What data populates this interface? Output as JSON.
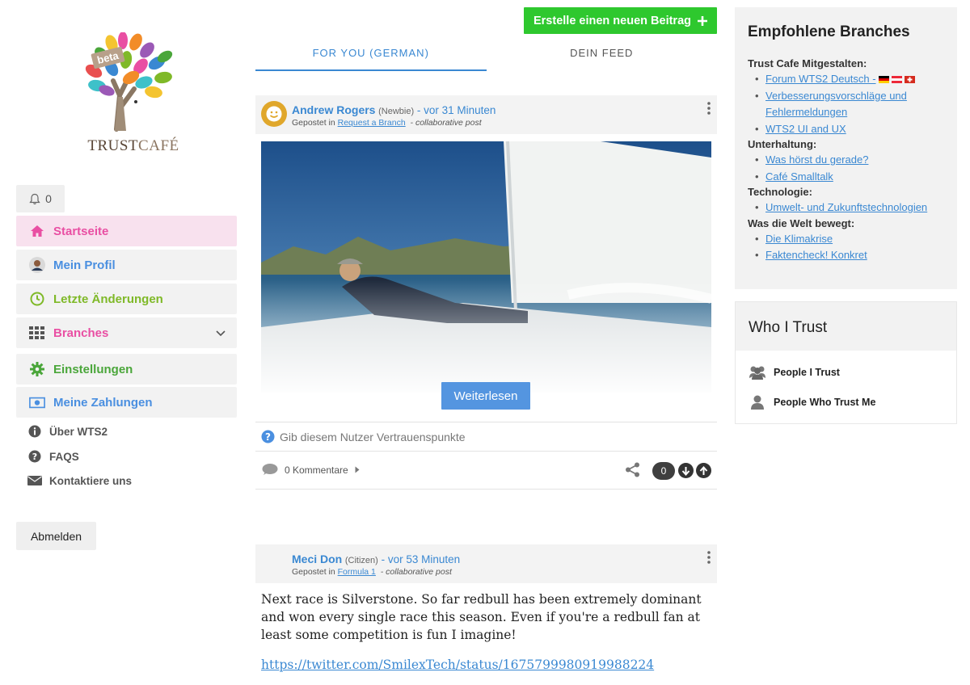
{
  "brand": {
    "beta": "beta",
    "word_trust": "TRUST",
    "word_cafe": "CAFÉ"
  },
  "notifications": {
    "count": "0",
    "icon": "bell-icon"
  },
  "nav": {
    "home": {
      "label": "Startseite",
      "color": "#e94fa3",
      "icon": "home-icon"
    },
    "profile": {
      "label": "Mein Profil",
      "color": "#4a8fe0",
      "icon": "avatar-icon"
    },
    "recent": {
      "label": "Letzte Änderungen",
      "color": "#7fb928",
      "icon": "clock-icon"
    },
    "branches": {
      "label": "Branches",
      "color": "#e94fa3",
      "icon": "grid-icon"
    },
    "settings": {
      "label": "Einstellungen",
      "color": "#4aa63a",
      "icon": "gear-icon"
    },
    "payments": {
      "label": "Meine Zahlungen",
      "color": "#4a8fe0",
      "icon": "money-icon"
    }
  },
  "mini_links": {
    "about": "Über WTS2",
    "faqs": "FAQS",
    "contact": "Kontaktiere uns"
  },
  "logout": "Abmelden",
  "new_post_button": "Erstelle einen neuen Beitrag",
  "tabs": [
    {
      "label": "FOR YOU (GERMAN)",
      "active": true
    },
    {
      "label": "DEIN FEED",
      "active": false
    }
  ],
  "post1": {
    "author": "Andrew Rogers",
    "rank": "(Newbie)",
    "separator": " - ",
    "time": "vor 31 Minuten",
    "posted_in_prefix": "Gepostet in",
    "branch": "Request a Branch",
    "kind": "- collaborative post",
    "read_more": "Weiterlesen",
    "trust_prompt": "Gib diesem Nutzer Vertrauenspunkte",
    "comments": "0 Kommentare",
    "score": "0"
  },
  "post2": {
    "author": "Meci Don",
    "rank": "(Citizen)",
    "separator": " - ",
    "time": "vor 53 Minuten",
    "posted_in_prefix": "Gepostet in",
    "branch": "Formula 1",
    "kind": "- collaborative post",
    "body": "Next race is Silverstone. So far redbull has been extremely dominant and won every single race this season. Even if you're a redbull fan at least some competition is fun I imagine!",
    "link": "https://twitter.com/SmilexTech/status/1675799980919988224"
  },
  "recommended": {
    "title": "Empfohlene Branches",
    "groups": [
      {
        "name": "Trust Cafe Mitgestalten:",
        "items": [
          "Forum WTS2 Deutsch -",
          "Verbesserungsvorschläge und Fehlermeldungen",
          "WTS2 UI and UX"
        ]
      },
      {
        "name": "Unterhaltung:",
        "items": [
          "Was hörst du gerade?",
          "Café Smalltalk"
        ]
      },
      {
        "name": "Technologie:",
        "items": [
          "Umwelt- und Zukunftstechnologien"
        ]
      },
      {
        "name": "Was die Welt bewegt:",
        "items": [
          "Die Klimakrise",
          "Faktencheck! Konkret"
        ]
      }
    ]
  },
  "who_i_trust": {
    "title": "Who I Trust",
    "people_i_trust": "People I Trust",
    "people_who_trust_me": "People Who Trust Me"
  }
}
